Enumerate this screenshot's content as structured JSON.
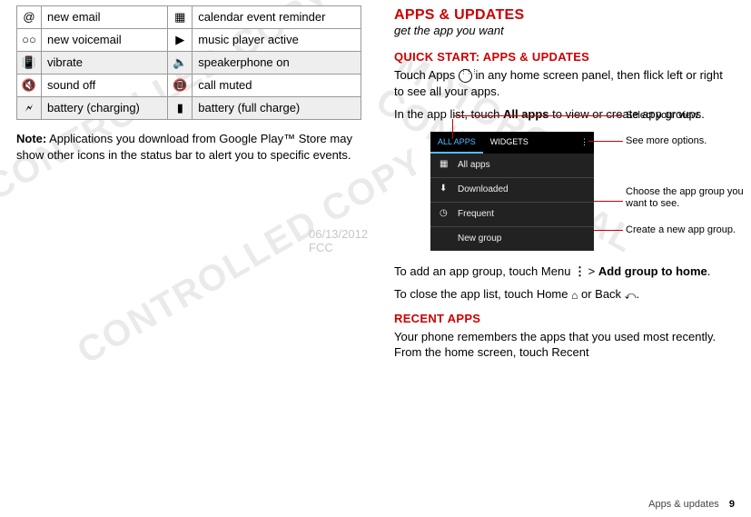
{
  "icon_table": {
    "rows": [
      {
        "icon_l": "@",
        "label_l": "new email",
        "icon_r": "▦",
        "label_r": "calendar event reminder"
      },
      {
        "icon_l": "○○",
        "label_l": "new voicemail",
        "icon_r": "▶",
        "label_r": "music player active"
      },
      {
        "icon_l": "📳",
        "label_l": "vibrate",
        "icon_r": "🔈",
        "label_r": "speakerphone on"
      },
      {
        "icon_l": "🔇",
        "label_l": "sound off",
        "icon_r": "📵",
        "label_r": "call muted"
      },
      {
        "icon_l": "🗲",
        "label_l": "battery (charging)",
        "icon_r": "▮",
        "label_r": "battery (full charge)"
      }
    ]
  },
  "left_note": {
    "bold": "Note:",
    "text": " Applications you download from Google Play™ Store may show other icons in the status bar to alert you to specific events."
  },
  "right": {
    "h2_main": "APPS & UPDATES",
    "tagline": "get the app you want",
    "h3_quick": "QUICK START: APPS & UPDATES",
    "p_quick1_a": "Touch Apps ",
    "p_quick1_b": " in any home screen panel, then flick left or right to see all your apps.",
    "p_quick2_a": "In the app list, touch ",
    "p_quick2_bold": "All apps",
    "p_quick2_b": " to view or create app groups.",
    "p_add_a": "To add an app group, touch Menu ",
    "p_add_b": " > ",
    "p_add_bold": "Add group to home",
    "p_add_c": ".",
    "p_close_a": "To close the app list, touch Home ",
    "p_close_b": " or Back ",
    "p_close_c": ".",
    "h3_recent": "RECENT APPS",
    "p_recent": "Your phone remembers the apps that you used most recently. From the home screen, touch Recent"
  },
  "phone_ui": {
    "tab_all": "ALL APPS",
    "tab_widgets": "WIDGETS",
    "menu_all": "All apps",
    "menu_dl": "Downloaded",
    "menu_freq": "Frequent",
    "menu_new": "New group"
  },
  "annotations": {
    "select_view": "Select your view.",
    "see_more": "See more options.",
    "choose_group": "Choose the app group you want to see.",
    "create_group": "Create a new app group."
  },
  "watermark": {
    "date": "06/13/2012",
    "fcc": "FCC"
  },
  "footer": {
    "section": "Apps & updates",
    "page": "9"
  }
}
